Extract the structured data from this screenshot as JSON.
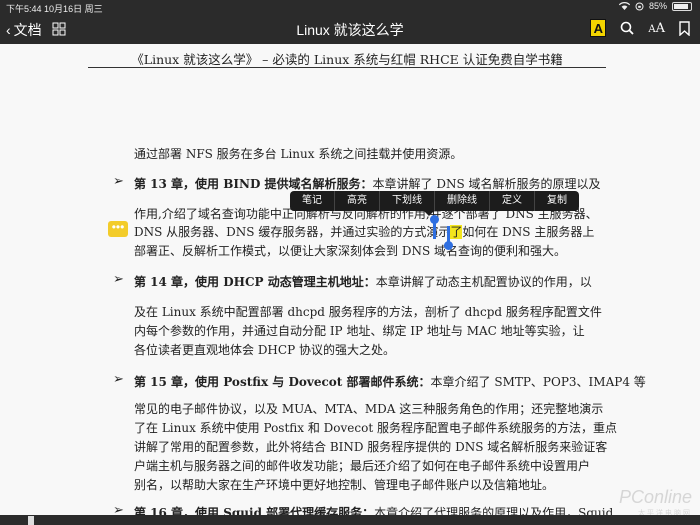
{
  "status": {
    "time": "下午5:44",
    "date": "10月16日 周三",
    "battery_percent": "85%",
    "battery_level": 0.85
  },
  "nav": {
    "back_label": "文档",
    "title": "Linux 就该这么学",
    "highlight_button": "A",
    "font_button_big": "A",
    "font_button_small": "A"
  },
  "page": {
    "header": "《Linux 就该这么学》 – 必读的 Linux 系统与红帽 RHCE 认证免费自学书籍",
    "lines": {
      "l1": "通过部署 NFS 服务在多台 Linux 系统之间挂载并使用资源。",
      "ch13_title": "第 13 章，使用 BIND 提供域名解析服务：",
      "ch13_l1": "本章讲解了 DNS 域名解析服务的原理以及",
      "ch13_l2": "作用,介绍了域名查询功能中正向解析与反向解析的作用,并逐个部署了 DNS 主服务器、",
      "ch13_l3a": "DNS 从服务器、DNS 缓存服务器，并通过实验的方式演示",
      "ch13_l3_mark": "了",
      "ch13_l3b": "如何在 DNS 主服务器上",
      "ch13_l4": "部署正、反解析工作模式，以便让大家深刻体会到 DNS 域名查询的便利和强大。",
      "ch14_title": "第 14 章，使用 DHCP 动态管理主机地址：",
      "ch14_l1": "本章讲解了动态主机配置协议的作用，以",
      "ch14_l2": "及在 Linux 系统中配置部署 dhcpd 服务程序的方法，剖析了 dhcpd 服务程序配置文件",
      "ch14_l3": "内每个参数的作用，并通过自动分配 IP 地址、绑定 IP 地址与 MAC 地址等实验，让",
      "ch14_l4": "各位读者更直观地体会 DHCP 协议的强大之处。",
      "ch15_title": "第 15 章，使用 Postfix 与 Dovecot 部署邮件系统：",
      "ch15_l1": "本章介绍了 SMTP、POP3、IMAP4 等",
      "ch15_l2": "常见的电子邮件协议，以及 MUA、MTA、MDA 这三种服务角色的作用；还完整地演示",
      "ch15_l3": "了在 Linux 系统中使用 Postfix 和 Dovecot 服务程序配置电子邮件系统服务的方法，重点",
      "ch15_l4": "讲解了常用的配置参数，此外将结合 BIND 服务程序提供的 DNS 域名解析服务来验证客",
      "ch15_l5": "户端主机与服务器之间的邮件收发功能；最后还介绍了如何在电子邮件系统中设置用户",
      "ch15_l6": "别名，以帮助大家在生产环境中更好地控制、管理电子邮件账户以及信箱地址。",
      "ch16_title": "第 16 章，使用 Squid 部署代理缓存服务：",
      "ch16_l1": "本章介绍了代理服务的原理以及作用，Squid"
    },
    "bullet": "➢"
  },
  "context_menu": [
    "笔记",
    "高亮",
    "下划线",
    "删除线",
    "定义",
    "复制"
  ],
  "note_icon": "•••",
  "watermark": {
    "brand": "PConline",
    "sub": "太平洋电脑网"
  },
  "colors": {
    "highlight": "#f3e51d",
    "selection": "#2f6fe0",
    "toolbar": "#2b2b2b",
    "note": "#f3cc2a"
  }
}
